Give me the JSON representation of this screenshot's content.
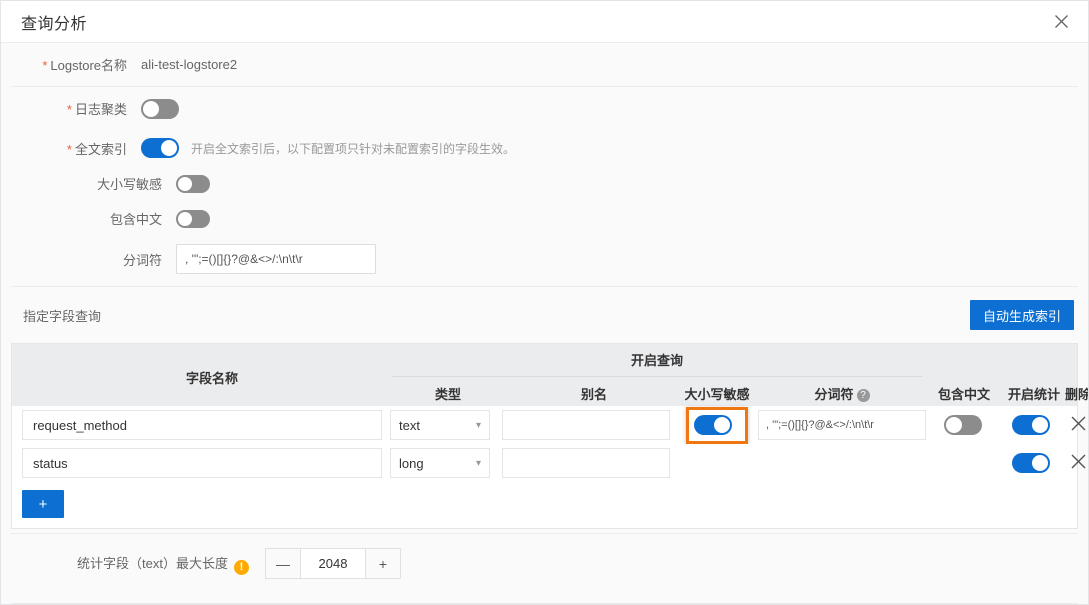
{
  "dialog": {
    "title": "查询分析",
    "close_icon": "close-icon"
  },
  "form": {
    "logstore_label": "Logstore名称",
    "logstore_value": "ali-test-logstore2",
    "log_cluster_label": "日志聚类",
    "log_cluster_on": false,
    "fulltext_label": "全文索引",
    "fulltext_on": true,
    "fulltext_hint": "开启全文索引后，以下配置项只针对未配置索引的字段生效。",
    "case_sensitive_label": "大小写敏感",
    "case_sensitive_on": false,
    "include_chinese_label": "包含中文",
    "include_chinese_on": false,
    "delimiter_label": "分词符",
    "delimiter_value": ", '\";=()[]{}?@&<>/:\\n\\t\\r",
    "required_star": "*"
  },
  "section": {
    "title": "指定字段查询",
    "auto_index_button": "自动生成索引"
  },
  "table": {
    "group_header": "开启查询",
    "headers": {
      "field_name": "字段名称",
      "type": "类型",
      "alias": "别名",
      "case_sensitive": "大小写敏感",
      "delimiter": "分词符",
      "delimiter_help": "?",
      "include_chinese": "包含中文",
      "enable_stats": "开启统计",
      "delete": "删除"
    },
    "rows": [
      {
        "field_name": "request_method",
        "type": "text",
        "alias": "",
        "case_sensitive_on": true,
        "delimiter": ", '\";=()[]{}?@&<>/:\\n\\t\\r",
        "include_chinese_on": false,
        "enable_stats_on": true,
        "has_delimiter": true,
        "has_include_chinese": true,
        "delete_icon": "close-icon"
      },
      {
        "field_name": "status",
        "type": "long",
        "alias": "",
        "case_sensitive_on": false,
        "delimiter": "",
        "include_chinese_on": false,
        "enable_stats_on": true,
        "has_delimiter": false,
        "has_include_chinese": false,
        "delete_icon": "close-icon"
      }
    ],
    "add_button": "+"
  },
  "footer": {
    "stat_label": "统计字段（text）最大长度",
    "warn_icon": "!",
    "decrement": "—",
    "max_length": "2048",
    "increment": "+"
  },
  "colors": {
    "accent": "#0d6fd1",
    "highlight_ring": "#ef7611",
    "required": "#e8613c",
    "warn": "#ffaa00"
  }
}
